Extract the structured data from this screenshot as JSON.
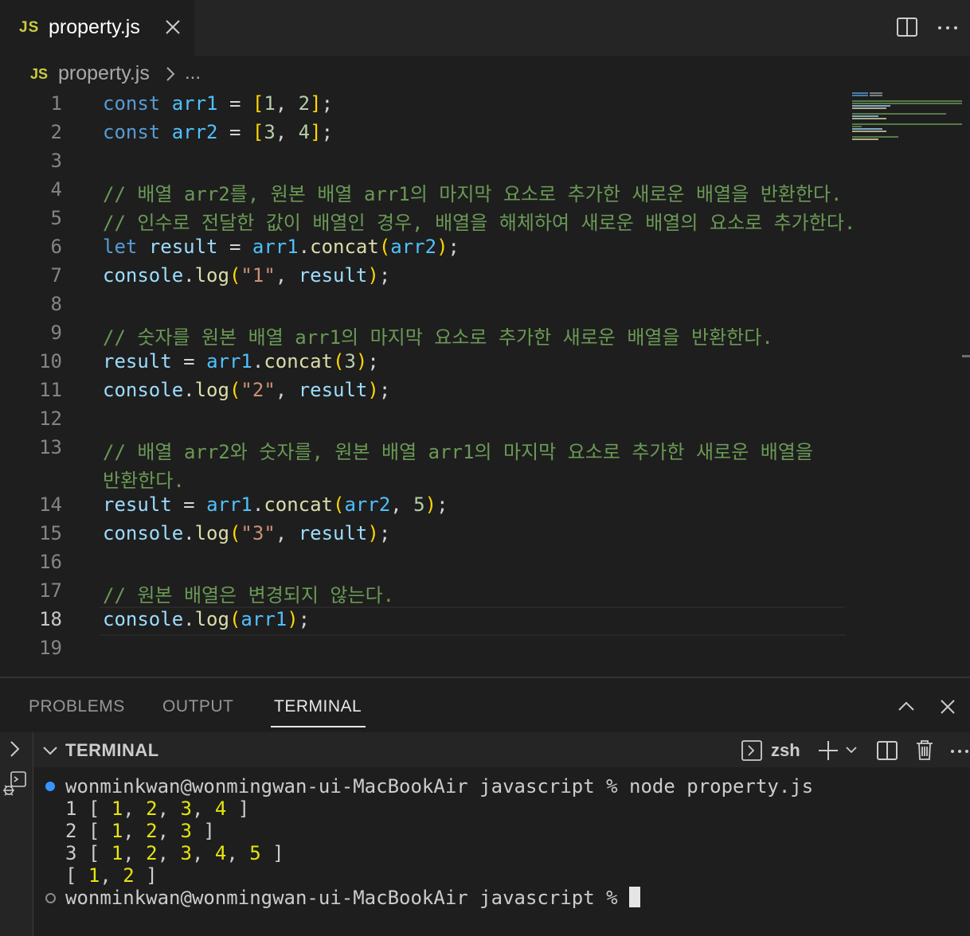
{
  "tab": {
    "icon_label": "JS",
    "filename": "property.js"
  },
  "breadcrumb": {
    "icon_label": "JS",
    "file": "property.js",
    "more": "..."
  },
  "editor": {
    "line_numbers": [
      "1",
      "2",
      "3",
      "4",
      "5",
      "6",
      "7",
      "8",
      "9",
      "10",
      "11",
      "12",
      "13",
      "14",
      "15",
      "16",
      "17",
      "18",
      "19"
    ],
    "active_line": "18",
    "code_tokens": {
      "const": "const",
      "let": "let",
      "arr1": "arr1",
      "arr2": "arr2",
      "result": "result",
      "console": "console",
      "log": "log",
      "concat": "concat",
      "n1": "1",
      "n2": "2",
      "n3": "3",
      "n4": "4",
      "n5": "5",
      "s1": "\"1\"",
      "s2": "\"2\"",
      "s3": "\"3\""
    },
    "comments": {
      "l4": "// 배열 arr2를, 원본 배열 arr1의 마지막 요소로 추가한 새로운 배열을 반환한다.",
      "l5": "// 인수로 전달한 값이 배열인 경우, 배열을 해체하여 새로운 배열의 요소로 추가한다.",
      "l9": "// 숫자를 원본 배열 arr1의 마지막 요소로 추가한 새로운 배열을 반환한다.",
      "l13a": "// 배열 arr2와 숫자를, 원본 배열 arr1의 마지막 요소로 추가한 새로운 배열을",
      "l13b": "반환한다.",
      "l17": "// 원본 배열은 변경되지 않는다."
    }
  },
  "panel": {
    "tabs": [
      "PROBLEMS",
      "OUTPUT",
      "TERMINAL"
    ],
    "active_tab": "TERMINAL",
    "terminal_title": "TERMINAL",
    "shell": "zsh"
  },
  "terminal": {
    "prompt": "wonminkwan@wonmingwan-ui-MacBookAir javascript % ",
    "command": "node property.js",
    "out1_label": "1",
    "out2_label": "2",
    "out3_label": "3",
    "out1_values": [
      "1",
      "2",
      "3",
      "4"
    ],
    "out2_values": [
      "1",
      "2",
      "3"
    ],
    "out3_values": [
      "1",
      "2",
      "3",
      "4",
      "5"
    ],
    "out4_values": [
      "1",
      "2"
    ]
  },
  "colors": {
    "editor_bg": "#1e1e1e",
    "keyword": "#569cd6",
    "comment": "#6a9955",
    "string": "#ce9178",
    "number": "#b5cea8",
    "terminal_number": "#e5e510"
  }
}
